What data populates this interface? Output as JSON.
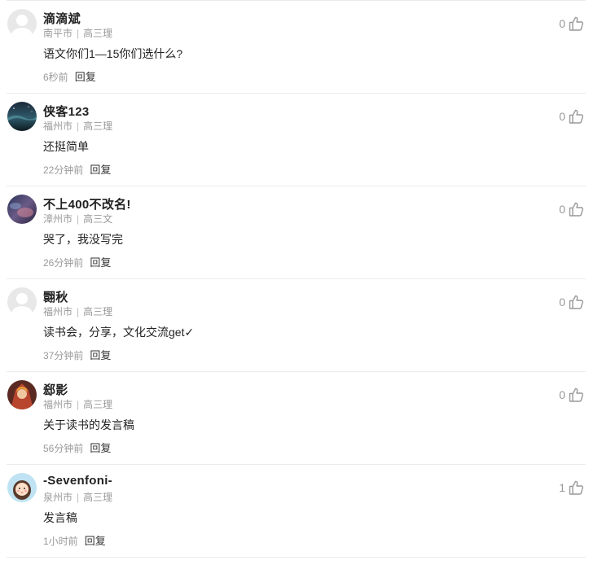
{
  "comments": [
    {
      "name": "滴滴斌",
      "city": "南平市",
      "grade": "高三理",
      "content": "语文你们1—15你们选什么?",
      "time": "6秒前",
      "reply_label": "回复",
      "likes": "0",
      "avatar": "default-avatar"
    },
    {
      "name": "侠客123",
      "city": "福州市",
      "grade": "高三理",
      "content": "还挺简单",
      "time": "22分钟前",
      "reply_label": "回复",
      "likes": "0",
      "avatar": "night-sky-avatar"
    },
    {
      "name": "不上400不改名!",
      "city": "漳州市",
      "grade": "高三文",
      "content": "哭了，我没写完",
      "time": "26分钟前",
      "reply_label": "回复",
      "likes": "0",
      "avatar": "dusk-sky-avatar"
    },
    {
      "name": "翾秋",
      "city": "福州市",
      "grade": "高三理",
      "content": "读书会，分享，文化交流get✓",
      "time": "37分钟前",
      "reply_label": "回复",
      "likes": "0",
      "avatar": "default-avatar"
    },
    {
      "name": "郄影",
      "city": "福州市",
      "grade": "高三理",
      "content": "关于读书的发言稿",
      "time": "56分钟前",
      "reply_label": "回复",
      "likes": "0",
      "avatar": "character-avatar"
    },
    {
      "name": "-Sevenfoni-",
      "city": "泉州市",
      "grade": "高三理",
      "content": "发言稿",
      "time": "1小时前",
      "reply_label": "回复",
      "likes": "1",
      "avatar": "cartoon-girl-avatar"
    }
  ]
}
